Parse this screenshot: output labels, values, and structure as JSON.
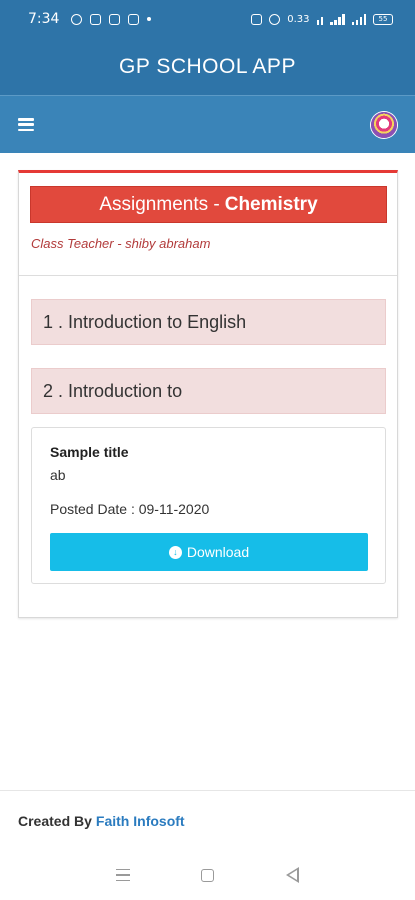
{
  "status_bar": {
    "time": "7:34",
    "left_icons": [
      "whatsapp-icon",
      "mail-icon",
      "photo-icon",
      "instagram-icon",
      "more-dot-icon"
    ],
    "right_icons": [
      "vibrate-icon",
      "alarm-icon",
      "data-speed-icon",
      "volte-icon",
      "signal-icon",
      "signal-icon",
      "battery-icon"
    ],
    "data_speed": "0.33",
    "battery": "55"
  },
  "header": {
    "app_title": "GP SCHOOL APP"
  },
  "nav": {
    "menu_icon": "hamburger-icon",
    "logo_icon": "school-logo-icon"
  },
  "assignments": {
    "heading_prefix": "Assignments -",
    "subject": "Chemistry",
    "class_teacher": "Class Teacher - shiby abraham",
    "items": [
      {
        "label": "1 . Introduction to English"
      },
      {
        "label": "2 . Introduction to"
      }
    ],
    "expanded": {
      "title": "Sample title",
      "description": "ab",
      "posted_date": "Posted Date : 09-11-2020",
      "download_label": "Download"
    }
  },
  "colors": {
    "header_blue": "#2e74a8",
    "banner_red": "#e1493d",
    "row_pink": "#f2dede",
    "download_cyan": "#16bde8",
    "link_blue": "#2a7bbf"
  },
  "footer": {
    "created_by": "Created By",
    "company": "Faith Infosoft"
  }
}
